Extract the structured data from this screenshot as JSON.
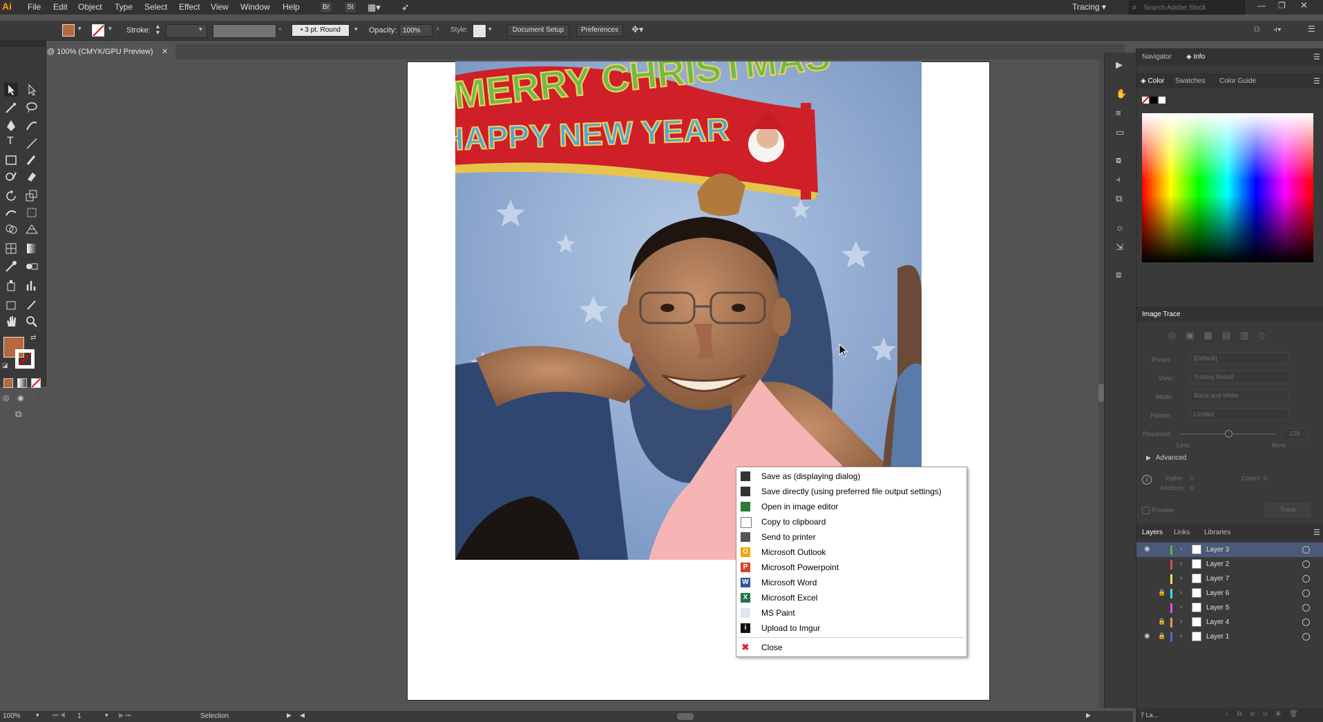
{
  "app": {
    "logo": "Ai",
    "menu": [
      "File",
      "Edit",
      "Object",
      "Type",
      "Select",
      "Effect",
      "View",
      "Window",
      "Help"
    ],
    "bridge_btn": "Br",
    "stock_btn": "St",
    "workspace": "Tracing",
    "search_placeholder": "Search Adobe Stock"
  },
  "controlbar": {
    "stroke_label": "Stroke:",
    "brush": "3 pt. Round",
    "opacity_label": "Opacity:",
    "opacity_value": "100%",
    "style_label": "Style:",
    "document_setup": "Document Setup",
    "preferences": "Preferences"
  },
  "document": {
    "tab_title": "@ 100% (CMYK/GPU Preview)",
    "fill_color": "#b5693c"
  },
  "photo": {
    "banner_line1": "MERRY CHRISTMAS",
    "banner_line2": "HAPPY NEW YEAR"
  },
  "context_menu": {
    "items": [
      {
        "label": "Save as (displaying dialog)",
        "icon": "floppy-icon"
      },
      {
        "label": "Save directly (using preferred file output settings)",
        "icon": "floppy-icon"
      },
      {
        "label": "Open in image editor",
        "icon": "image-editor-icon"
      },
      {
        "label": "Copy to clipboard",
        "icon": "clipboard-icon"
      },
      {
        "label": "Send to printer",
        "icon": "printer-icon"
      },
      {
        "label": "Microsoft Outlook",
        "icon": "outlook-icon",
        "glyph": "O"
      },
      {
        "label": "Microsoft Powerpoint",
        "icon": "powerpoint-icon",
        "glyph": "P"
      },
      {
        "label": "Microsoft Word",
        "icon": "word-icon",
        "glyph": "W"
      },
      {
        "label": "Microsoft Excel",
        "icon": "excel-icon",
        "glyph": "X"
      },
      {
        "label": "MS Paint",
        "icon": "paint-icon"
      },
      {
        "label": "Upload to Imgur",
        "icon": "imgur-icon",
        "glyph": "i"
      }
    ],
    "close": "Close"
  },
  "panels": {
    "navigator": "Navigator",
    "info": "Info",
    "color": "Color",
    "swatches": "Swatches",
    "color_guide": "Color Guide",
    "image_trace": {
      "title": "Image Trace",
      "preset_label": "Preset:",
      "preset_value": "[Default]",
      "view_label": "View:",
      "view_value": "Tracing Result",
      "mode_label": "Mode:",
      "mode_value": "Black and White",
      "palette_label": "Palette:",
      "palette_value": "Limited",
      "threshold_label": "Threshold:",
      "threshold_value": "128",
      "less": "Less",
      "more": "More",
      "advanced": "Advanced",
      "paths_label": "Paths:",
      "paths_value": "0",
      "colors_label": "Colors:",
      "colors_value": "0",
      "anchors_label": "Anchors:",
      "anchors_value": "0",
      "preview": "Preview",
      "trace": "Trace"
    },
    "layers_tab": "Layers",
    "links_tab": "Links",
    "libraries_tab": "Libraries",
    "layers": [
      {
        "name": "Layer 3",
        "color": "#4fb84f",
        "visible": true,
        "locked": false,
        "selected": true
      },
      {
        "name": "Layer 2",
        "color": "#e84a4a",
        "visible": false,
        "locked": false,
        "selected": false
      },
      {
        "name": "Layer 7",
        "color": "#e8e84a",
        "visible": false,
        "locked": false,
        "selected": false
      },
      {
        "name": "Layer 6",
        "color": "#4ad8e8",
        "visible": false,
        "locked": true,
        "selected": false
      },
      {
        "name": "Layer 5",
        "color": "#e84ae8",
        "visible": false,
        "locked": false,
        "selected": false
      },
      {
        "name": "Layer 4",
        "color": "#e89a4a",
        "visible": false,
        "locked": true,
        "selected": false
      },
      {
        "name": "Layer 1",
        "color": "#4a6ae8",
        "visible": true,
        "locked": true,
        "selected": false
      }
    ],
    "layers_count": "7 La..."
  },
  "status": {
    "zoom": "100%",
    "page": "1",
    "tool": "Selection"
  }
}
